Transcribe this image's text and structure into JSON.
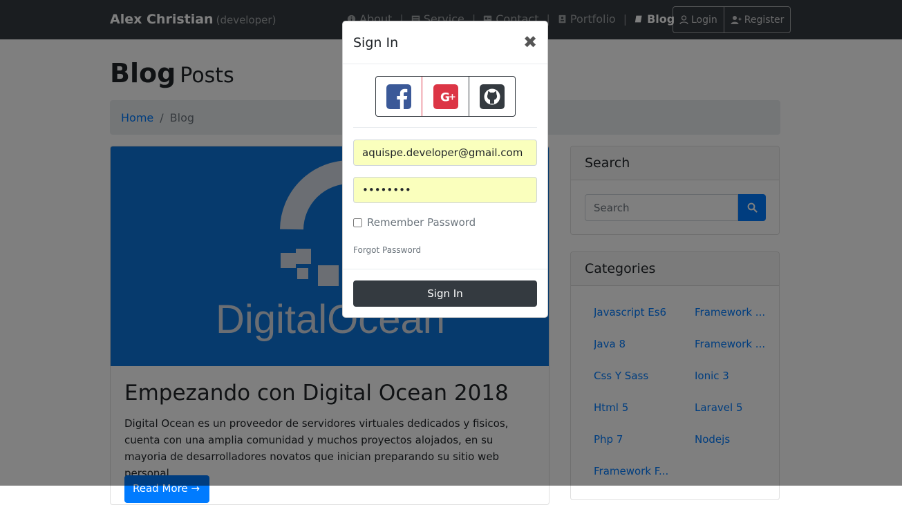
{
  "navbar": {
    "brand": "Alex Christian",
    "brand_sub": "(developer)",
    "items": [
      {
        "label": "About",
        "icon": "info-circle-icon"
      },
      {
        "label": "Service",
        "icon": "list-icon"
      },
      {
        "label": "Contact",
        "icon": "address-card-icon"
      },
      {
        "label": "Portfolio",
        "icon": "portfolio-icon"
      },
      {
        "label": "Blog",
        "icon": "book-icon",
        "active": true
      }
    ],
    "login_label": "Login",
    "register_label": "Register"
  },
  "page": {
    "title_main": "Blog",
    "title_sub": "Posts",
    "breadcrumb": {
      "home": "Home",
      "separator": "/",
      "current": "Blog"
    }
  },
  "post": {
    "image_brand": "DigitalOcean",
    "title": "Empezando con Digital Ocean 2018",
    "excerpt": "Digital Ocean es un proveedor de servidores virtuales dedicados y fisicos, cuenta con una amplia comunidad y muchos proyectos alojados, en su mayoria de desarrolladores novatos que inician preparando su sitio web personal.",
    "read_more": "Read More →"
  },
  "sidebar": {
    "search_title": "Search",
    "search_placeholder": "Search",
    "categories_title": "Categories",
    "categories": [
      "Javascript Es6",
      "Framework ...",
      "Java 8",
      "Framework ...",
      "Css Y Sass",
      "Ionic 3",
      "Html 5",
      "Laravel 5",
      "Php 7",
      "Nodejs",
      "Framework F..."
    ]
  },
  "modal": {
    "title": "Sign In",
    "close": "✖",
    "email_value": "aquispe.developer@gmail.com",
    "password_value": "••••••••",
    "remember_label": "Remember Password",
    "forgot_label": "Forgot Password",
    "submit_label": "Sign In"
  },
  "colors": {
    "navbar": "#343a40",
    "primary": "#007bff",
    "digitalocean_blue": "#0d75db",
    "facebook": "#3b5998",
    "google": "#dc3545",
    "github": "#343a40",
    "autofill": "#faffbd"
  }
}
